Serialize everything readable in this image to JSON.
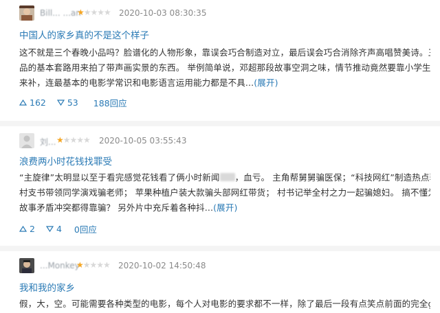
{
  "reviews": [
    {
      "user": "Bill... ...an",
      "stars_filled": 1,
      "stars_total": 5,
      "date": "2020-10-03 08:30:35",
      "title": "中国人的家乡真的不是这个样子",
      "body_lines": [
        "这不就是三个春晚小品吗？脸谱化的人物形象，靠误会巧合制造对立，最后误会巧合消除齐声高唱赞美诗。三段式小",
        "品的基本套路用来拍了带声画实景的东西。 举例简单说，邓超那段故事空洞之味，情节推动竟然要靠小学生朗诵台词",
        "来补，连最基本的电影学常识和电影语言运用能力都是不具..."
      ],
      "expand_label": "(展开)",
      "likes": "162",
      "dislikes": "53",
      "replies": "188回应"
    },
    {
      "user": "刘...",
      "stars_filled": 1,
      "stars_total": 5,
      "date": "2020-10-05 03:55:43",
      "title": "浪费两小时花钱找罪受",
      "body_lines_a": "“主旋律”太明显以至于看完感觉花钱看了俩小时新闻",
      "body_lines_b": "，血亏。 主角帮舅舅骗医保；“科技网红”制造热点骗流量；",
      "body_lines": [
        "村支书带领同学演戏骗老师； 苹果种植户装大款骗头部网红带货； 村书记举全村之力一起骗媳妇。 搞不懂为什么所有",
        "故事矛盾冲突都得靠骗？ 另外片中充斥着各种抖..."
      ],
      "expand_label": "(展开)",
      "likes": "2",
      "dislikes": "4",
      "replies": "0回应"
    },
    {
      "user": "...Monkey",
      "stars_filled": 1,
      "stars_total": 5,
      "date": "2020-10-02 14:50:48",
      "title": "我和我的家乡",
      "body_lines": [
        "假，大，空。可能需要各种类型的电影，每个人对电影的要求都不一样，除了最后一段有点笑点前面的完全get不到，"
      ]
    }
  ],
  "colors": {
    "link": "#2a7ab5",
    "star": "#f5a623",
    "separator": "#f4f4f4"
  },
  "icons": {
    "like": "triangle-up-icon",
    "dislike": "triangle-down-icon"
  }
}
